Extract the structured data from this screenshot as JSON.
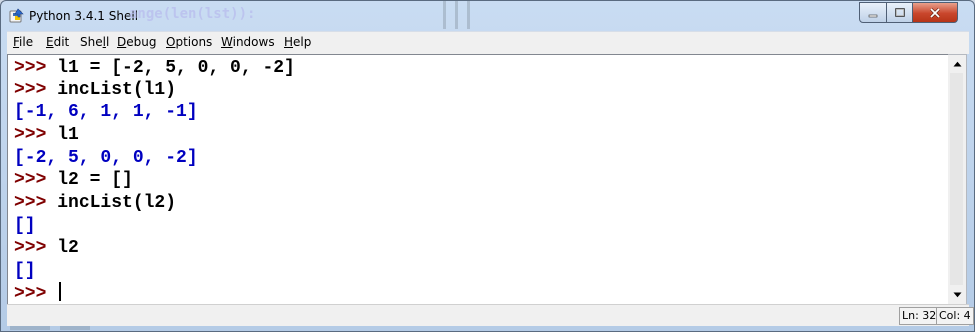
{
  "window": {
    "title": "Python 3.4.1 Shell",
    "background_ghost_text": "ange(len(lst)):",
    "controls": {
      "minimize": "minimize",
      "maximize": "maximize",
      "close": "close"
    }
  },
  "menubar": {
    "items": [
      {
        "mnemonic": "F",
        "rest": "ile"
      },
      {
        "pre": "E",
        "mnemonic": "",
        "rest": "dit"
      },
      {
        "pre": "She",
        "mnemonic": "l",
        "rest": "l"
      },
      {
        "mnemonic": "D",
        "rest": "ebug"
      },
      {
        "mnemonic": "O",
        "rest": "ptions"
      },
      {
        "mnemonic": "W",
        "rest": "indows"
      },
      {
        "mnemonic": "H",
        "rest": "elp"
      }
    ]
  },
  "shell": {
    "prompt": ">>> ",
    "lines": [
      {
        "kind": "cmd",
        "text": "l1 = [-2, 5, 0, 0, -2]"
      },
      {
        "kind": "cmd",
        "text": "incList(l1)"
      },
      {
        "kind": "out",
        "text": "[-1, 6, 1, 1, -1]"
      },
      {
        "kind": "cmd",
        "text": "l1"
      },
      {
        "kind": "out",
        "text": "[-2, 5, 0, 0, -2]"
      },
      {
        "kind": "cmd",
        "text": "l2 = []"
      },
      {
        "kind": "cmd",
        "text": "incList(l2)"
      },
      {
        "kind": "out",
        "text": "[]"
      },
      {
        "kind": "cmd",
        "text": "l2"
      },
      {
        "kind": "out",
        "text": "[]"
      },
      {
        "kind": "prompt",
        "text": ""
      }
    ]
  },
  "status": {
    "line": "Ln: 32",
    "col": "Col: 4"
  },
  "colors": {
    "prompt": "#7f0000",
    "command": "#000000",
    "output": "#0000c0"
  }
}
